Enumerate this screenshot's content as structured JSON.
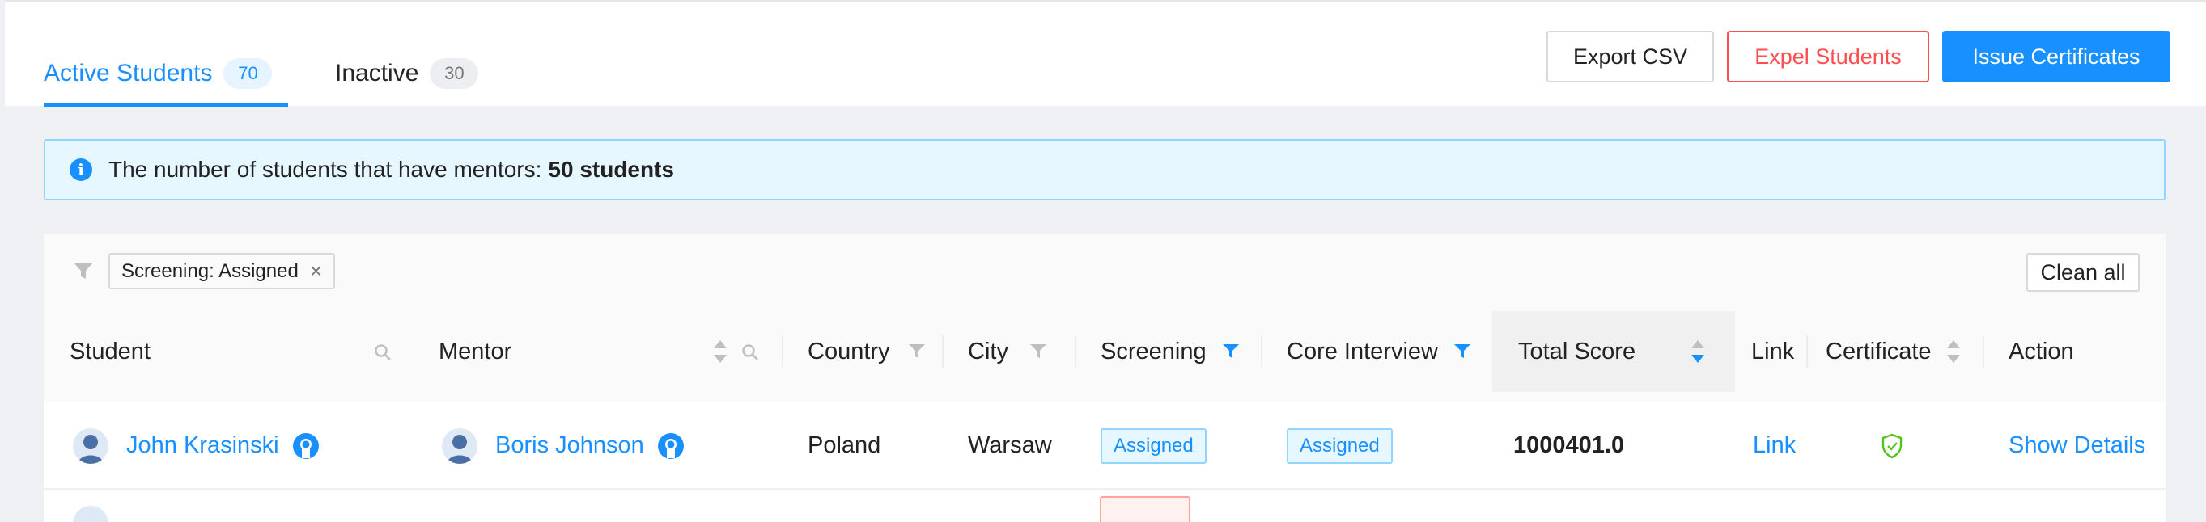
{
  "tabs": [
    {
      "label": "Active Students",
      "count": "70",
      "active": true
    },
    {
      "label": "Inactive",
      "count": "30",
      "active": false
    }
  ],
  "header_actions": {
    "export_label": "Export CSV",
    "expel_label": "Expel Students",
    "issue_label": "Issue Certificates"
  },
  "alert": {
    "icon": "info-icon",
    "text": "The number of students that have mentors:",
    "value": "50 students"
  },
  "filters": {
    "icon": "filter-icon",
    "chips": [
      {
        "label": "Screening: Assigned"
      }
    ],
    "clean_all_label": "Clean all"
  },
  "table": {
    "columns": {
      "student": "Student",
      "mentor": "Mentor",
      "country": "Country",
      "city": "City",
      "screening": "Screening",
      "core_interview": "Core Interview",
      "total_score": "Total Score",
      "link": "Link",
      "certificate": "Certificate",
      "action": "Action"
    },
    "rows": [
      {
        "student": "John Krasinski",
        "mentor": "Boris Johnson",
        "country": "Poland",
        "city": "Warsaw",
        "screening": "Assigned",
        "core_interview": "Assigned",
        "total_score": "1000401.0",
        "link": "Link",
        "certificate_icon": "shield-check-icon",
        "action": "Show Details"
      }
    ]
  },
  "colors": {
    "primary": "#1890ff",
    "danger": "#ff4d4f",
    "success": "#52c41a",
    "alert_bg": "#e6f7ff",
    "page_bg": "#eff0f3"
  }
}
